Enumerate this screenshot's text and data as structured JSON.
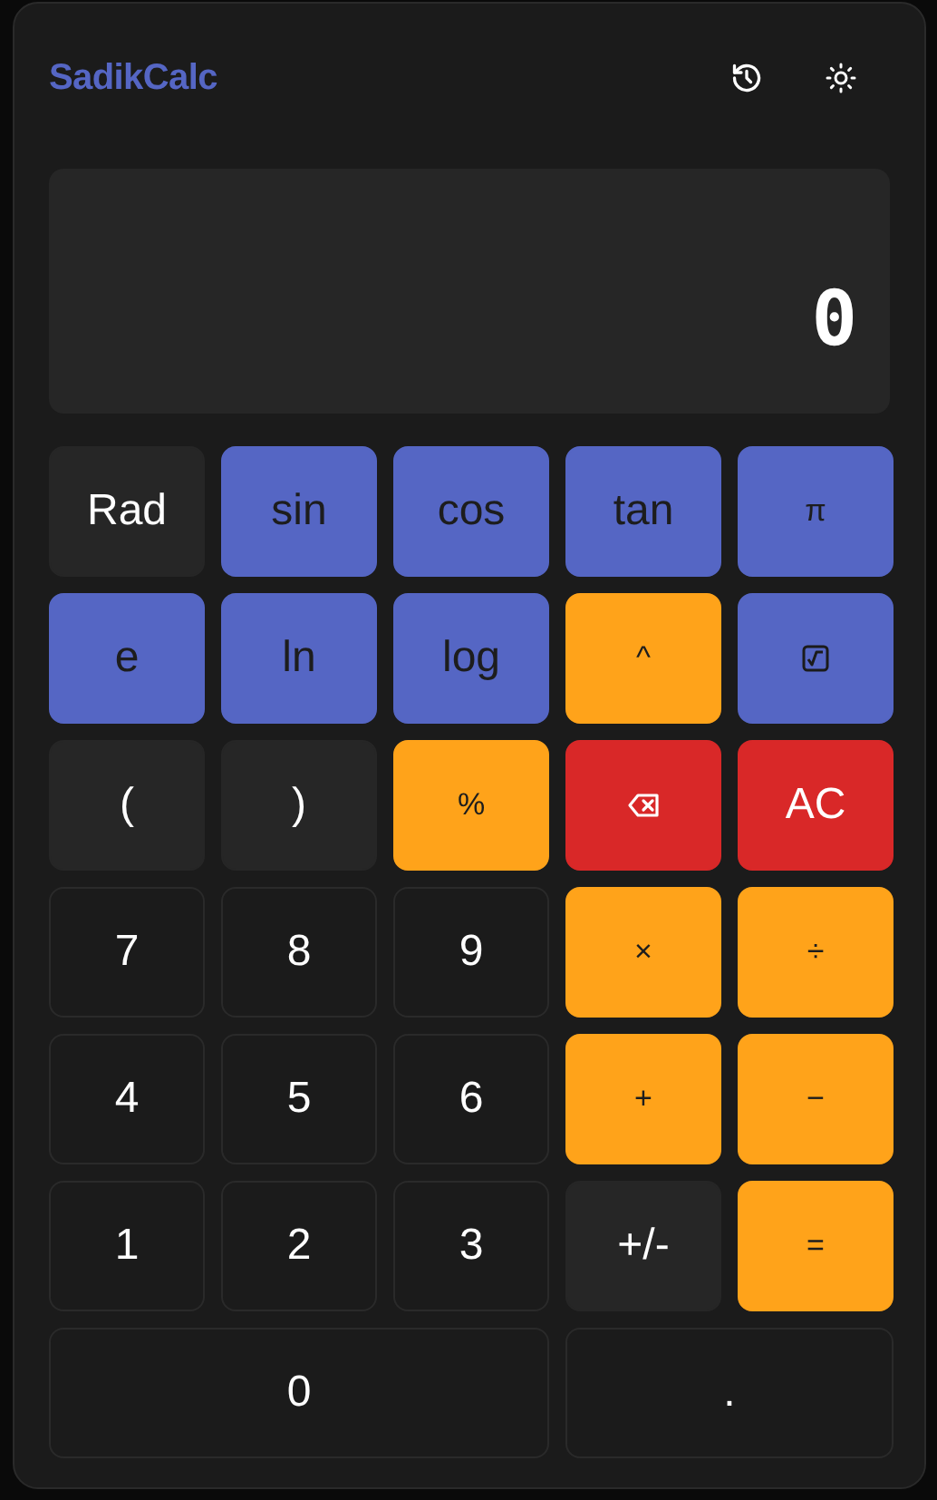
{
  "app": {
    "title": "SadikCalc"
  },
  "header_buttons": [
    {
      "kind": "history"
    },
    {
      "kind": "theme"
    }
  ],
  "display": {
    "value": "0"
  },
  "keys": [
    {
      "label": "Rad",
      "kind": "misc"
    },
    {
      "label": "sin",
      "kind": "fn"
    },
    {
      "label": "cos",
      "kind": "fn"
    },
    {
      "label": "tan",
      "kind": "fn"
    },
    {
      "label": "π",
      "kind": "symbol"
    },
    {
      "label": "e",
      "kind": "fn"
    },
    {
      "label": "ln",
      "kind": "fn"
    },
    {
      "label": "log",
      "kind": "fn"
    },
    {
      "label": "^",
      "kind": "op"
    },
    {
      "kind": "sqrt"
    },
    {
      "label": "(",
      "kind": "misc"
    },
    {
      "label": ")",
      "kind": "misc"
    },
    {
      "label": "%",
      "kind": "op"
    },
    {
      "kind": "backspace"
    },
    {
      "label": "AC",
      "kind": "danger"
    },
    {
      "label": "7",
      "kind": "num"
    },
    {
      "label": "8",
      "kind": "num"
    },
    {
      "label": "9",
      "kind": "num"
    },
    {
      "label": "×",
      "kind": "op"
    },
    {
      "label": "÷",
      "kind": "op"
    },
    {
      "label": "4",
      "kind": "num"
    },
    {
      "label": "5",
      "kind": "num"
    },
    {
      "label": "6",
      "kind": "num"
    },
    {
      "label": "+",
      "kind": "op"
    },
    {
      "label": "−",
      "kind": "op"
    },
    {
      "label": "1",
      "kind": "num"
    },
    {
      "label": "2",
      "kind": "num"
    },
    {
      "label": "3",
      "kind": "num"
    },
    {
      "label": "+/-",
      "kind": "misc"
    },
    {
      "label": "=",
      "kind": "op"
    },
    {
      "label": "0",
      "kind": "num-wide3"
    },
    {
      "label": ".",
      "kind": "num-wide2"
    }
  ]
}
